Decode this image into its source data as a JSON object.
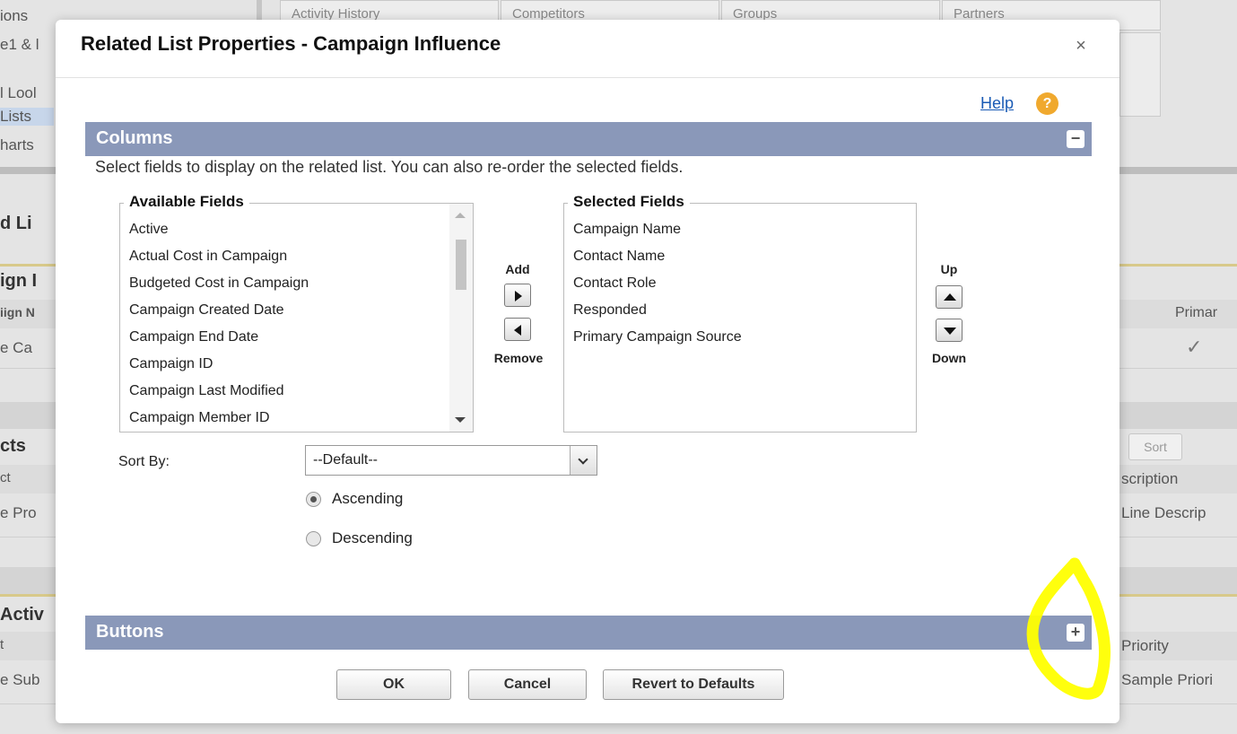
{
  "background": {
    "tabs": [
      "Activity History",
      "Competitors",
      "Groups",
      "Partners"
    ],
    "sidebar_items": [
      "ions",
      "e1 & l",
      "l Lool",
      "Lists",
      "harts"
    ],
    "fragments": [
      "d Li",
      "ign I",
      "iign N",
      "e Ca",
      "cts",
      "ct",
      "e Pro",
      "Activ",
      "t",
      "e Sub",
      "Primar",
      "scription",
      "Line Descrip",
      "Priority",
      "Sample Priori"
    ],
    "sort_button": "Sort",
    "checkmark": "✓"
  },
  "modal": {
    "title": "Related List Properties - Campaign Influence",
    "close_label": "×",
    "help_label": "Help",
    "help_icon": "?",
    "columns_section": {
      "title": "Columns",
      "toggle": "−",
      "description": "Select fields to display on the related list. You can also re-order the selected fields."
    },
    "available_fields": {
      "legend": "Available Fields",
      "items": [
        "Active",
        "Actual Cost in Campaign",
        "Budgeted Cost in Campaign",
        "Campaign Created Date",
        "Campaign End Date",
        "Campaign ID",
        "Campaign Last Modified",
        "Campaign Member ID"
      ]
    },
    "selected_fields": {
      "legend": "Selected Fields",
      "items": [
        "Campaign Name",
        "Contact Name",
        "Contact Role",
        "Responded",
        "Primary Campaign Source"
      ]
    },
    "add_label": "Add",
    "remove_label": "Remove",
    "up_label": "Up",
    "down_label": "Down",
    "sort": {
      "label": "Sort By:",
      "selected": "--Default--",
      "ascending_label": "Ascending",
      "descending_label": "Descending",
      "order": "Ascending"
    },
    "buttons_section": {
      "title": "Buttons",
      "toggle": "+"
    },
    "actions": {
      "ok": "OK",
      "cancel": "Cancel",
      "revert": "Revert to Defaults"
    }
  },
  "colors": {
    "section_bar": "#8a98b9",
    "help_icon": "#f0a92e",
    "highlight": "#ffff00",
    "link": "#1a5bb5"
  }
}
